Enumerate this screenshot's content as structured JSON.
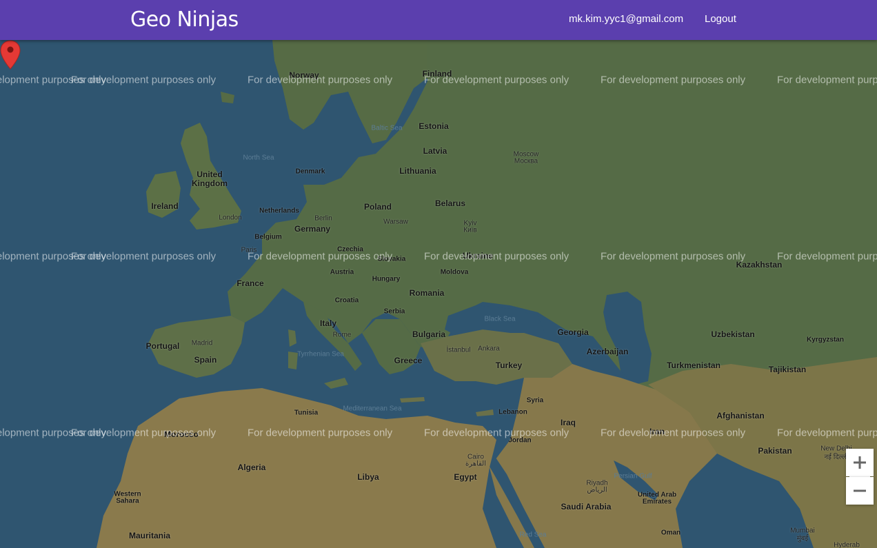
{
  "header": {
    "brand": "Geo Ninjas",
    "user_email": "mk.kim.yyc1@gmail.com",
    "logout_label": "Logout"
  },
  "map": {
    "watermark_text": "For development purposes only",
    "marker_city": "London",
    "labels": {
      "norway": "Norway",
      "finland": "Finland",
      "estonia": "Estonia",
      "latvia": "Latvia",
      "lithuania": "Lithuania",
      "denmark": "Denmark",
      "united_kingdom_1": "United",
      "united_kingdom_2": "Kingdom",
      "ireland": "Ireland",
      "netherlands": "Netherlands",
      "belgium": "Belgium",
      "germany": "Germany",
      "poland": "Poland",
      "belarus": "Belarus",
      "czechia": "Czechia",
      "slovakia": "Slovakia",
      "austria": "Austria",
      "hungary": "Hungary",
      "moldova": "Moldova",
      "romania": "Romania",
      "croatia": "Croatia",
      "serbia": "Serbia",
      "italy": "Italy",
      "bulgaria": "Bulgaria",
      "greece": "Greece",
      "turkey": "Turkey",
      "georgia": "Georgia",
      "azerbaijan": "Azerbaijan",
      "kazakhstan": "Kazakhstan",
      "uzbekistan": "Uzbekistan",
      "kyrgyzstan": "Kyrgyzstan",
      "turkmenistan": "Turkmenistan",
      "tajikistan": "Tajikistan",
      "afghanistan": "Afghanistan",
      "pakistan": "Pakistan",
      "france": "France",
      "portugal": "Portugal",
      "spain": "Spain",
      "tunisia": "Tunisia",
      "algeria": "Algeria",
      "libya": "Libya",
      "egypt": "Egypt",
      "syria": "Syria",
      "lebanon": "Lebanon",
      "iraq": "Iraq",
      "jordan": "Jordan",
      "iran": "Iran",
      "saudi_arabia": "Saudi Arabia",
      "uae_1": "United Arab",
      "uae_2": "Emirates",
      "oman": "Oman",
      "western_sahara_1": "Western",
      "western_sahara_2": "Sahara",
      "mauritania": "Mauritania",
      "morocco": "Morocco",
      "ukraine": "Ukraine",
      "baltic_sea": "Baltic Sea",
      "north_sea": "North Sea",
      "black_sea": "Black Sea",
      "tyrrhenian_sea": "Tyrrhenian Sea",
      "mediterranean_sea": "Mediterranean Sea",
      "persian_gulf": "Persian Gulf",
      "red_sea": "Red Sea",
      "moscow_1": "Moscow",
      "moscow_2": "Москва",
      "berlin": "Berlin",
      "warsaw": "Warsaw",
      "kyiv_1": "Kyiv",
      "kyiv_2": "Київ",
      "paris": "Paris",
      "rome": "Rome",
      "madrid": "Madrid",
      "istanbul": "İstanbul",
      "ankara": "Ankara",
      "cairo_1": "Cairo",
      "cairo_2": "القاهرة",
      "riyadh_1": "Riyadh",
      "riyadh_2": "الرياض",
      "new_delhi_1": "New Delhi",
      "new_delhi_2": "नई दिल्ली",
      "mumbai_1": "Mumbai",
      "mumbai_2": "मुंबई",
      "hyderabad": "Hyderab"
    }
  },
  "controls": {
    "zoom_in_icon": "plus-icon",
    "zoom_out_icon": "minus-icon"
  },
  "colors": {
    "navbar": "#5b3fae",
    "water": "#2f5570",
    "land": "#5a6e47",
    "desert": "#8a7a4c",
    "marker": "#e53935"
  }
}
